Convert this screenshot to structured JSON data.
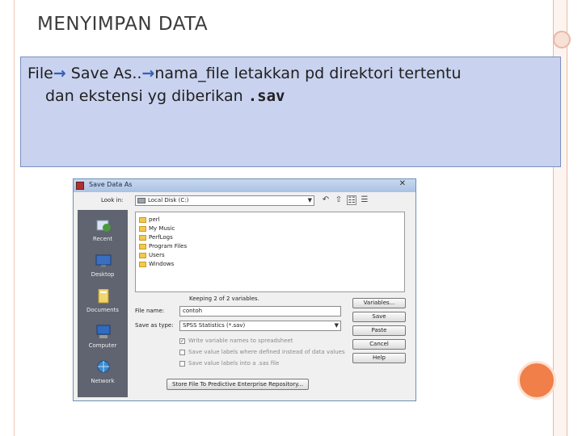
{
  "slide": {
    "title": "MENYIMPAN DATA",
    "line1": {
      "part1": "File",
      "part2": " Save As..",
      "part3": "nama_file letakkan pd direktori tertentu"
    },
    "line2": {
      "text": "dan ekstensi yg diberikan ",
      "extension": ".sav"
    },
    "arrow_glyph": "→"
  },
  "dialog": {
    "title": "Save Data As",
    "close_glyph": "✕",
    "look_in_label": "Look in:",
    "look_in_value": "Local Disk (C:)",
    "places": [
      {
        "label": "Recent",
        "icon": "recent-icon"
      },
      {
        "label": "Desktop",
        "icon": "desktop-icon"
      },
      {
        "label": "Documents",
        "icon": "documents-icon"
      },
      {
        "label": "Computer",
        "icon": "computer-icon"
      },
      {
        "label": "Network",
        "icon": "network-icon"
      }
    ],
    "files": [
      "perl",
      "My Music",
      "PerfLogs",
      "Program Files",
      "Users",
      "Windows"
    ],
    "keeping_text": "Keeping 2 of 2 variables.",
    "file_name_label": "File name:",
    "file_name_value": "contoh",
    "save_type_label": "Save as type:",
    "save_type_value": "SPSS Statistics (*.sav)",
    "buttons": {
      "variables": "Variables...",
      "save": "Save",
      "paste": "Paste",
      "cancel": "Cancel",
      "help": "Help"
    },
    "checkboxes": [
      {
        "label": "Write variable names to spreadsheet",
        "checked": true
      },
      {
        "label": "Save value labels where defined instead of data values",
        "checked": false
      },
      {
        "label": "Save value labels into a .sas file",
        "checked": false
      }
    ],
    "repository_button": "Store File To Predictive Enterprise Repository..."
  },
  "colors": {
    "content_bg": "#c9d3ef",
    "arrow": "#3660b8",
    "accent_circle": "#f07f4a"
  }
}
